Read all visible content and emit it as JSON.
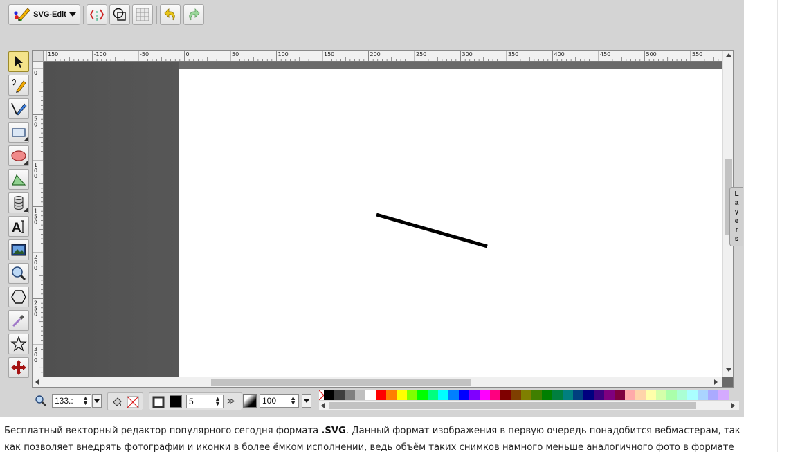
{
  "app": {
    "menu_button_label": "SVG-Edit",
    "layers_tab_label": "Layers"
  },
  "toolbar": {
    "buttons": [
      {
        "name": "source-button",
        "icon": "svg-source-icon"
      },
      {
        "name": "wireframe-button",
        "icon": "wireframe-icon"
      },
      {
        "name": "grid-button",
        "icon": "grid-icon"
      },
      {
        "name": "undo-button",
        "icon": "undo-icon"
      },
      {
        "name": "redo-button",
        "icon": "redo-icon"
      }
    ]
  },
  "tools": [
    {
      "name": "select-tool",
      "icon": "arrow-pointer-icon",
      "active": true
    },
    {
      "name": "freehand-tool",
      "icon": "pencil-icon"
    },
    {
      "name": "path-tool",
      "icon": "pen-icon"
    },
    {
      "name": "rect-tool",
      "icon": "rectangle-icon",
      "flyout": true
    },
    {
      "name": "ellipse-tool",
      "icon": "ellipse-icon",
      "flyout": true
    },
    {
      "name": "polygon-tool",
      "icon": "triangle-icon"
    },
    {
      "name": "library-tool",
      "icon": "cylinder-icon",
      "flyout": true
    },
    {
      "name": "text-tool",
      "icon": "text-icon"
    },
    {
      "name": "image-tool",
      "icon": "image-icon"
    },
    {
      "name": "zoom-tool",
      "icon": "magnifier-icon"
    },
    {
      "name": "shape-tool",
      "icon": "hexagon-icon"
    },
    {
      "name": "eyedropper-tool",
      "icon": "eyedropper-icon"
    },
    {
      "name": "star-tool",
      "icon": "star-icon"
    },
    {
      "name": "move-tool",
      "icon": "move-arrows-icon"
    }
  ],
  "ruler": {
    "h_labels": [
      "150",
      "-100",
      "-50",
      "0",
      "50",
      "100",
      "150",
      "200",
      "250",
      "300",
      "350",
      "400",
      "450",
      "500",
      "550"
    ],
    "v_labels": [
      "0",
      "50",
      "100",
      "150",
      "200",
      "250",
      "300"
    ]
  },
  "bottom": {
    "zoom_value": "133.:",
    "stroke_width": "5",
    "opacity": "100"
  },
  "colors": {
    "palette": [
      "#000000",
      "#3f3f3f",
      "#7f7f7f",
      "#bfbfbf",
      "#ffffff",
      "#ff0000",
      "#ff7f00",
      "#ffff00",
      "#7fff00",
      "#00ff00",
      "#00ff7f",
      "#00ffff",
      "#007fff",
      "#0000ff",
      "#7f00ff",
      "#ff00ff",
      "#ff007f",
      "#7f0000",
      "#7f3f00",
      "#7f7f00",
      "#3f7f00",
      "#007f00",
      "#007f3f",
      "#007f7f",
      "#003f7f",
      "#00007f",
      "#3f007f",
      "#7f007f",
      "#7f003f",
      "#ffaaaa",
      "#ffd4aa",
      "#ffffaa",
      "#d4ffaa",
      "#aaffaa",
      "#aaffd4",
      "#aaffff",
      "#aad4ff",
      "#aaaaff",
      "#d4aaff"
    ],
    "fill": "#000000",
    "accent": "#f4e38a"
  },
  "caption": {
    "line1_a": "Бесплатный векторный редактор популярного сегодня формата ",
    "line1_b": ".SVG",
    "line1_c": ". Данный формат изображения в первую очередь понадобится вебмастерам, так",
    "line2": "как позволяет внедрять фотографии и иконки в более ёмком исполнении, ведь объём таких снимков намного меньше аналогичного фото в формате"
  }
}
